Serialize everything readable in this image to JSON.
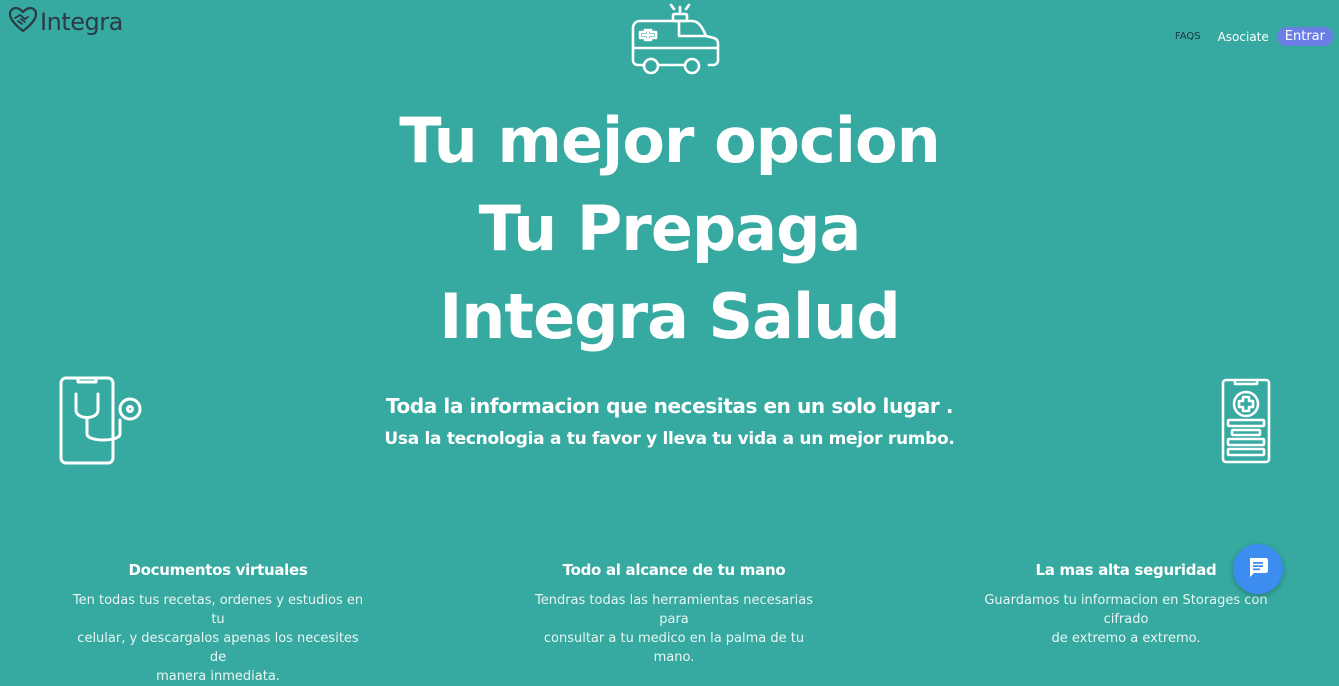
{
  "header": {
    "logo_text": "Integra",
    "logo_icon": "heart-handshake-icon",
    "nav": {
      "faqs": "FAQS",
      "asociate": "Asociate",
      "entrar": "Entrar"
    }
  },
  "hero": {
    "icon": "ambulance-icon",
    "line1": "Tu mejor opcion",
    "line2": "Tu Prepaga",
    "line3": "Integra Salud",
    "subtitle": "Toda la informacion que necesitas en un solo lugar .",
    "tagline": "Usa la tecnologia a tu favor y lleva tu vida a un mejor rumbo.",
    "left_icon": "phone-stethoscope-icon",
    "right_icon": "medical-record-icon"
  },
  "features": [
    {
      "title": "Documentos virtuales",
      "text_lines": [
        "Ten todas tus recetas, ordenes y estudios en tu",
        "celular, y descargalos apenas los necesites de",
        "manera inmediata."
      ]
    },
    {
      "title": "Todo al alcance de tu mano",
      "text_lines": [
        "Tendras todas las herramientas necesarias para",
        "consultar a tu medico en la palma de tu mano."
      ]
    },
    {
      "title": "La mas alta seguridad",
      "text_lines": [
        "Guardamos tu informacion en Storages con cifrado",
        "de extremo a extremo."
      ]
    }
  ],
  "chat_button": {
    "icon": "chat-icon"
  },
  "colors": {
    "background": "#36a9a0",
    "accent": "#6a7ee6",
    "chat": "#3d8df0",
    "logo_text": "#2b3a45"
  }
}
